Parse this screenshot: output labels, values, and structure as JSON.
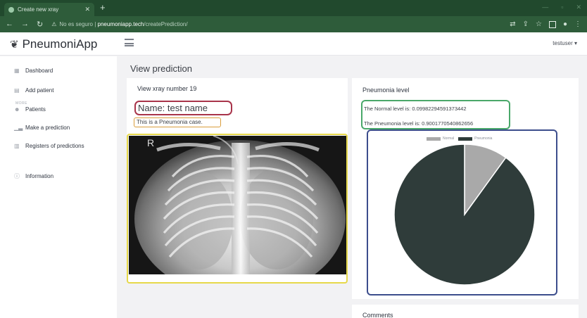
{
  "browser": {
    "tab_title": "Create new xray",
    "tab_close": "✕",
    "new_tab": "+",
    "url_warning": "No es seguro",
    "url_host": "pneumoniapp.tech",
    "url_path": "/createPrediction/"
  },
  "app": {
    "brand": "PneumoniApp",
    "user": "testuser"
  },
  "sidebar": {
    "section_label": "MORE",
    "items": [
      {
        "label": "Dashboard",
        "icon": "grid-icon"
      },
      {
        "label": "Add patient",
        "icon": "id-card-icon"
      },
      {
        "label": "Patients",
        "icon": "users-icon"
      },
      {
        "label": "Make a prediction",
        "icon": "chart-icon"
      },
      {
        "label": "Registers of predictions",
        "icon": "table-icon"
      },
      {
        "label": "Information",
        "icon": "info-icon"
      }
    ]
  },
  "main": {
    "page_title": "View prediction",
    "xray_card": {
      "title": "View xray number 19",
      "name": "Name: test name",
      "case": "This is a Pneumonia case.",
      "image_marker": "R"
    },
    "level_card": {
      "title": "Pneumonia level",
      "normal_line": "The Normal level is: 0.09982294591373442",
      "pneumonia_line": "The Pneumonia level is: 0.9001770540862656"
    },
    "comments_card": {
      "title": "Comments"
    }
  },
  "colors": {
    "normal": "#a9a9a9",
    "pneumonia": "#2f3c3a",
    "highlight_name": "#a8344a",
    "highlight_case": "#d99c3a",
    "highlight_image": "#e6d84a",
    "highlight_levels": "#4aa86a",
    "highlight_chart": "#3c4d8c"
  },
  "chart_data": {
    "type": "pie",
    "categories": [
      "Normal",
      "Pneumonia"
    ],
    "values": [
      0.09982294591373442,
      0.9001770540862656
    ],
    "legend_position": "top"
  }
}
